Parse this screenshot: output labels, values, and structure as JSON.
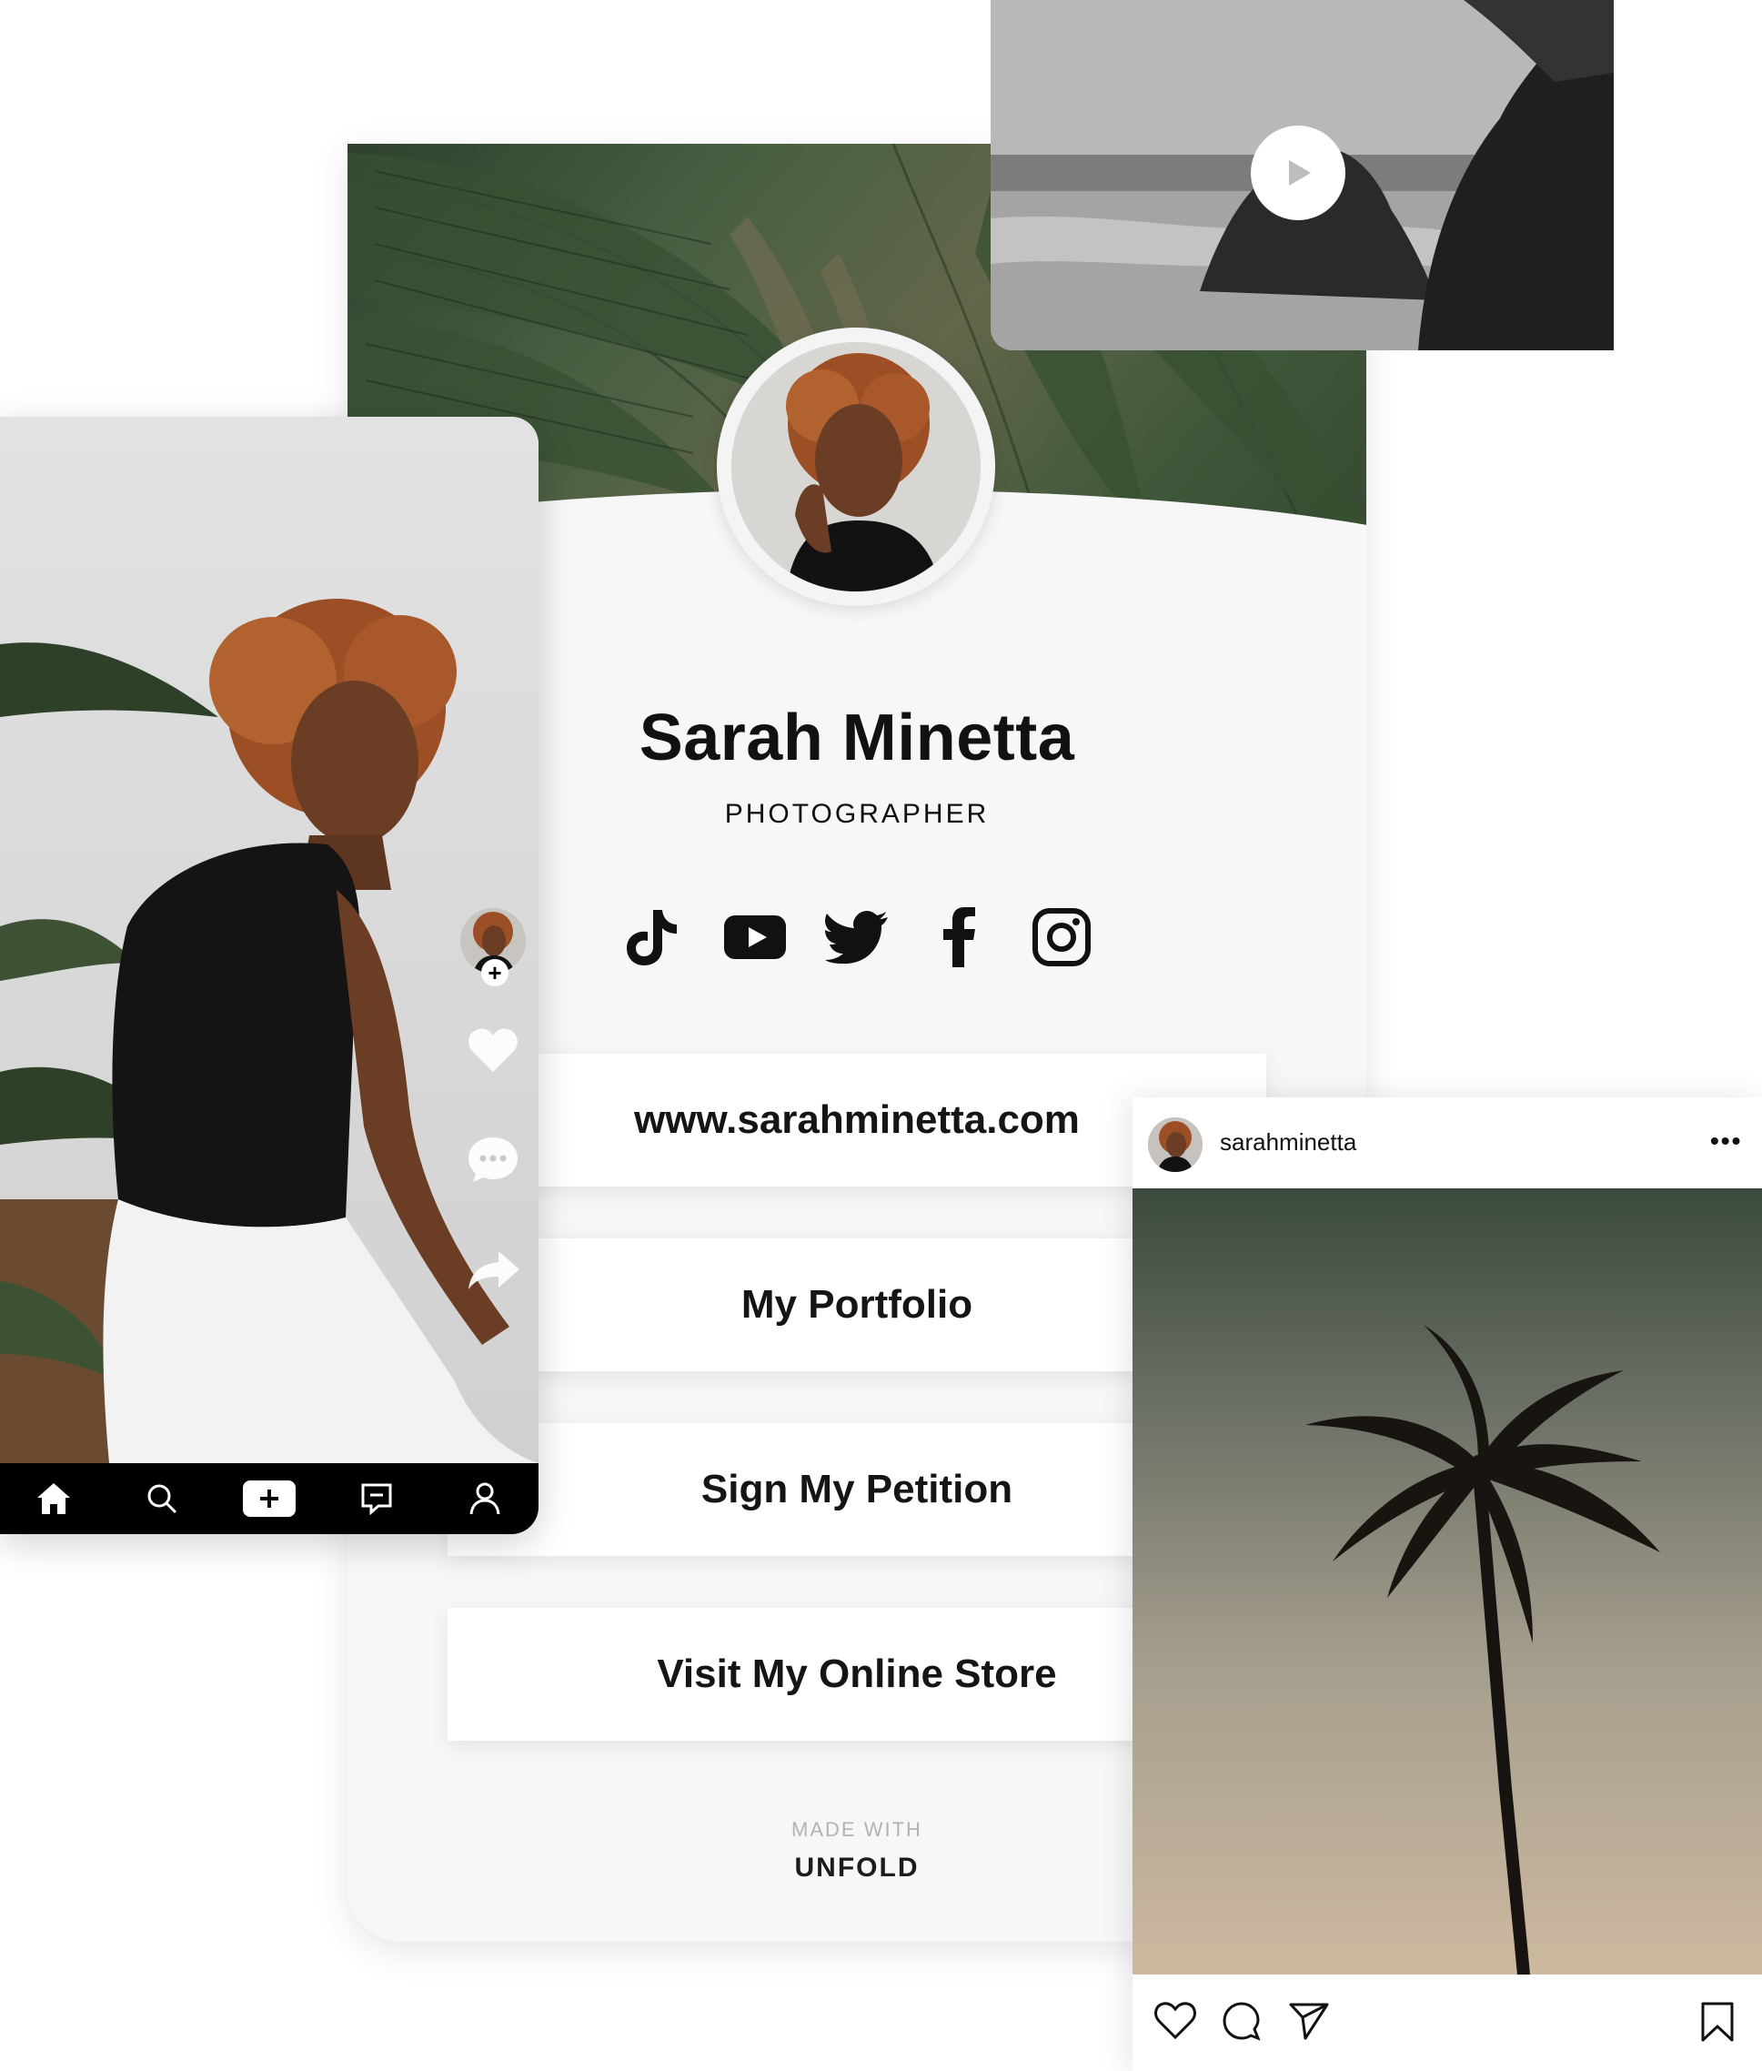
{
  "profile": {
    "name": "Sarah Minetta",
    "role": "PHOTOGRAPHER",
    "socials": [
      "tiktok-icon",
      "youtube-icon",
      "twitter-icon",
      "facebook-icon",
      "instagram-icon"
    ],
    "links": [
      {
        "label": "www.sarahminetta.com"
      },
      {
        "label": "My Portfolio"
      },
      {
        "label": "Sign My Petition"
      },
      {
        "label": "Visit My Online Store"
      }
    ],
    "footer_made": "MADE WITH",
    "footer_brand": "UNFOLD"
  },
  "video": {
    "play_icon": "play-icon"
  },
  "tiktok": {
    "side_icons": [
      "heart-icon",
      "comment-icon",
      "share-icon"
    ],
    "nav_icons": [
      "home-icon",
      "search-icon",
      "create-icon",
      "inbox-icon",
      "profile-icon"
    ],
    "follow_glyph": "+"
  },
  "instagram": {
    "username": "sarahminetta",
    "more": "•••",
    "actions": [
      "like-icon",
      "comment-icon",
      "send-icon",
      "bookmark-icon"
    ]
  },
  "colors": {
    "text": "#111111",
    "card_bg": "#f7f7f7",
    "muted": "#b3b3b3",
    "leaf_green": "#4a5e42"
  }
}
